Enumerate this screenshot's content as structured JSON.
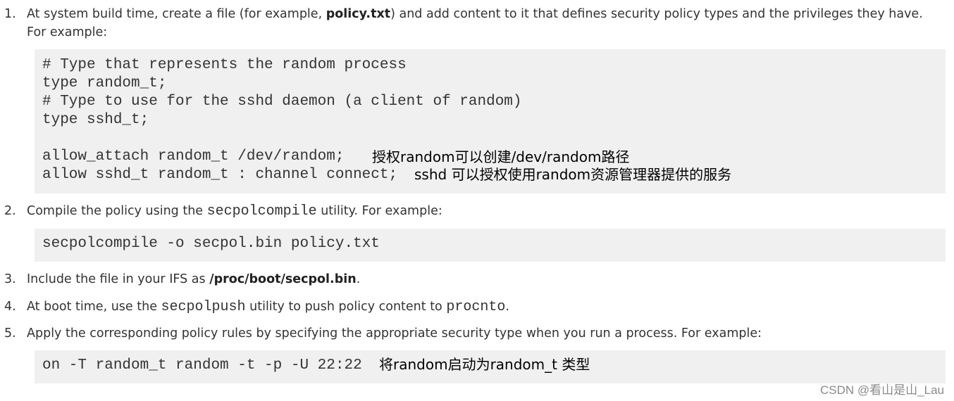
{
  "steps": [
    {
      "number": "1.",
      "pre": "At system build time, create a file (for example, ",
      "bold": "policy.txt",
      "post": ") and add content to it that defines security policy types and the privileges they have.",
      "line2": "For example:"
    },
    {
      "number": "2.",
      "pre": "Compile the policy using the ",
      "code": "secpolcompile",
      "post": " utility. For example:"
    },
    {
      "number": "3.",
      "pre": "Include the file in your IFS as ",
      "bold": "/proc/boot/secpol.bin",
      "post": "."
    },
    {
      "number": "4.",
      "pre": "At boot time, use the ",
      "code": "secpolpush",
      "mid": " utility to push policy content to ",
      "code2": "procnto",
      "post": "."
    },
    {
      "number": "5.",
      "pre": "Apply the corresponding policy rules by specifying the appropriate security type when you run a process. For example:"
    }
  ],
  "code1": {
    "lines": [
      "# Type that represents the random process",
      "type random_t;",
      "# Type to use for the sshd daemon (a client of random)",
      "type sshd_t;",
      "allow_attach random_t /dev/random;",
      "allow sshd_t random_t : channel connect;"
    ],
    "notes": [
      "授权random可以创建/dev/random路径",
      "sshd 可以授权使用random资源管理器提供的服务"
    ]
  },
  "code2": {
    "lines": [
      "secpolcompile -o secpol.bin policy.txt"
    ]
  },
  "code3": {
    "lines": [
      "on -T random_t random -t -p -U 22:22"
    ],
    "notes": [
      "将random启动为random_t 类型"
    ]
  },
  "watermark": "CSDN @看山是山_Lau"
}
